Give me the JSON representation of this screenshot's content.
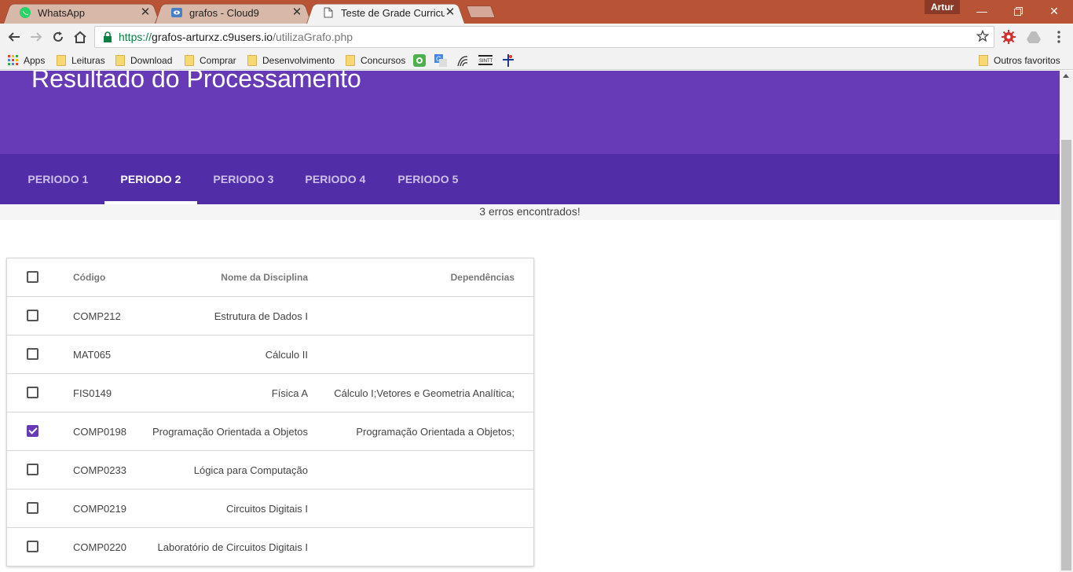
{
  "browser": {
    "tabs": [
      {
        "title": "WhatsApp",
        "icon": "whatsapp-icon",
        "active": false
      },
      {
        "title": "grafos - Cloud9",
        "icon": "cloud9-icon",
        "active": false
      },
      {
        "title": "Teste de Grade Curricular",
        "icon": "page-icon",
        "active": true
      }
    ],
    "profile": "Artur",
    "url": {
      "scheme": "https://",
      "host": "grafos-arturxz.c9users.io",
      "path": "/utilizaGrafo.php"
    },
    "bookmarks": {
      "apps": "Apps",
      "folders": [
        "Leituras",
        "Download",
        "Comprar",
        "Desenvolvimento",
        "Concursos"
      ],
      "other": "Outros favoritos"
    }
  },
  "page": {
    "title": "Resultado do Processamento",
    "tabs": [
      "PERIODO 1",
      "PERIODO 2",
      "PERIODO 3",
      "PERIODO 4",
      "PERIODO 5"
    ],
    "active_tab": "PERIODO 2",
    "error_message": "3 erros encontrados!",
    "table": {
      "headers": {
        "code": "Código",
        "name": "Nome da Disciplina",
        "deps": "Dependências"
      },
      "rows": [
        {
          "code": "COMP212",
          "name": "Estrutura de Dados I",
          "deps": "",
          "checked": false
        },
        {
          "code": "MAT065",
          "name": "Cálculo II",
          "deps": "",
          "checked": false
        },
        {
          "code": "FIS0149",
          "name": "Física A",
          "deps": "Cálculo I;Vetores e Geometria Analítica;",
          "checked": false
        },
        {
          "code": "COMP0198",
          "name": "Programação Orientada a Objetos",
          "deps": "Programação Orientada a Objetos;",
          "checked": true
        },
        {
          "code": "COMP0233",
          "name": "Lógica para Computação",
          "deps": "",
          "checked": false
        },
        {
          "code": "COMP0219",
          "name": "Circuitos Digitais I",
          "deps": "",
          "checked": false
        },
        {
          "code": "COMP0220",
          "name": "Laboratório de Circuitos Digitais I",
          "deps": "",
          "checked": false
        }
      ]
    }
  },
  "colors": {
    "header": "#673ab7",
    "tabsbar": "#512da8",
    "titlebar": "#b85336"
  }
}
